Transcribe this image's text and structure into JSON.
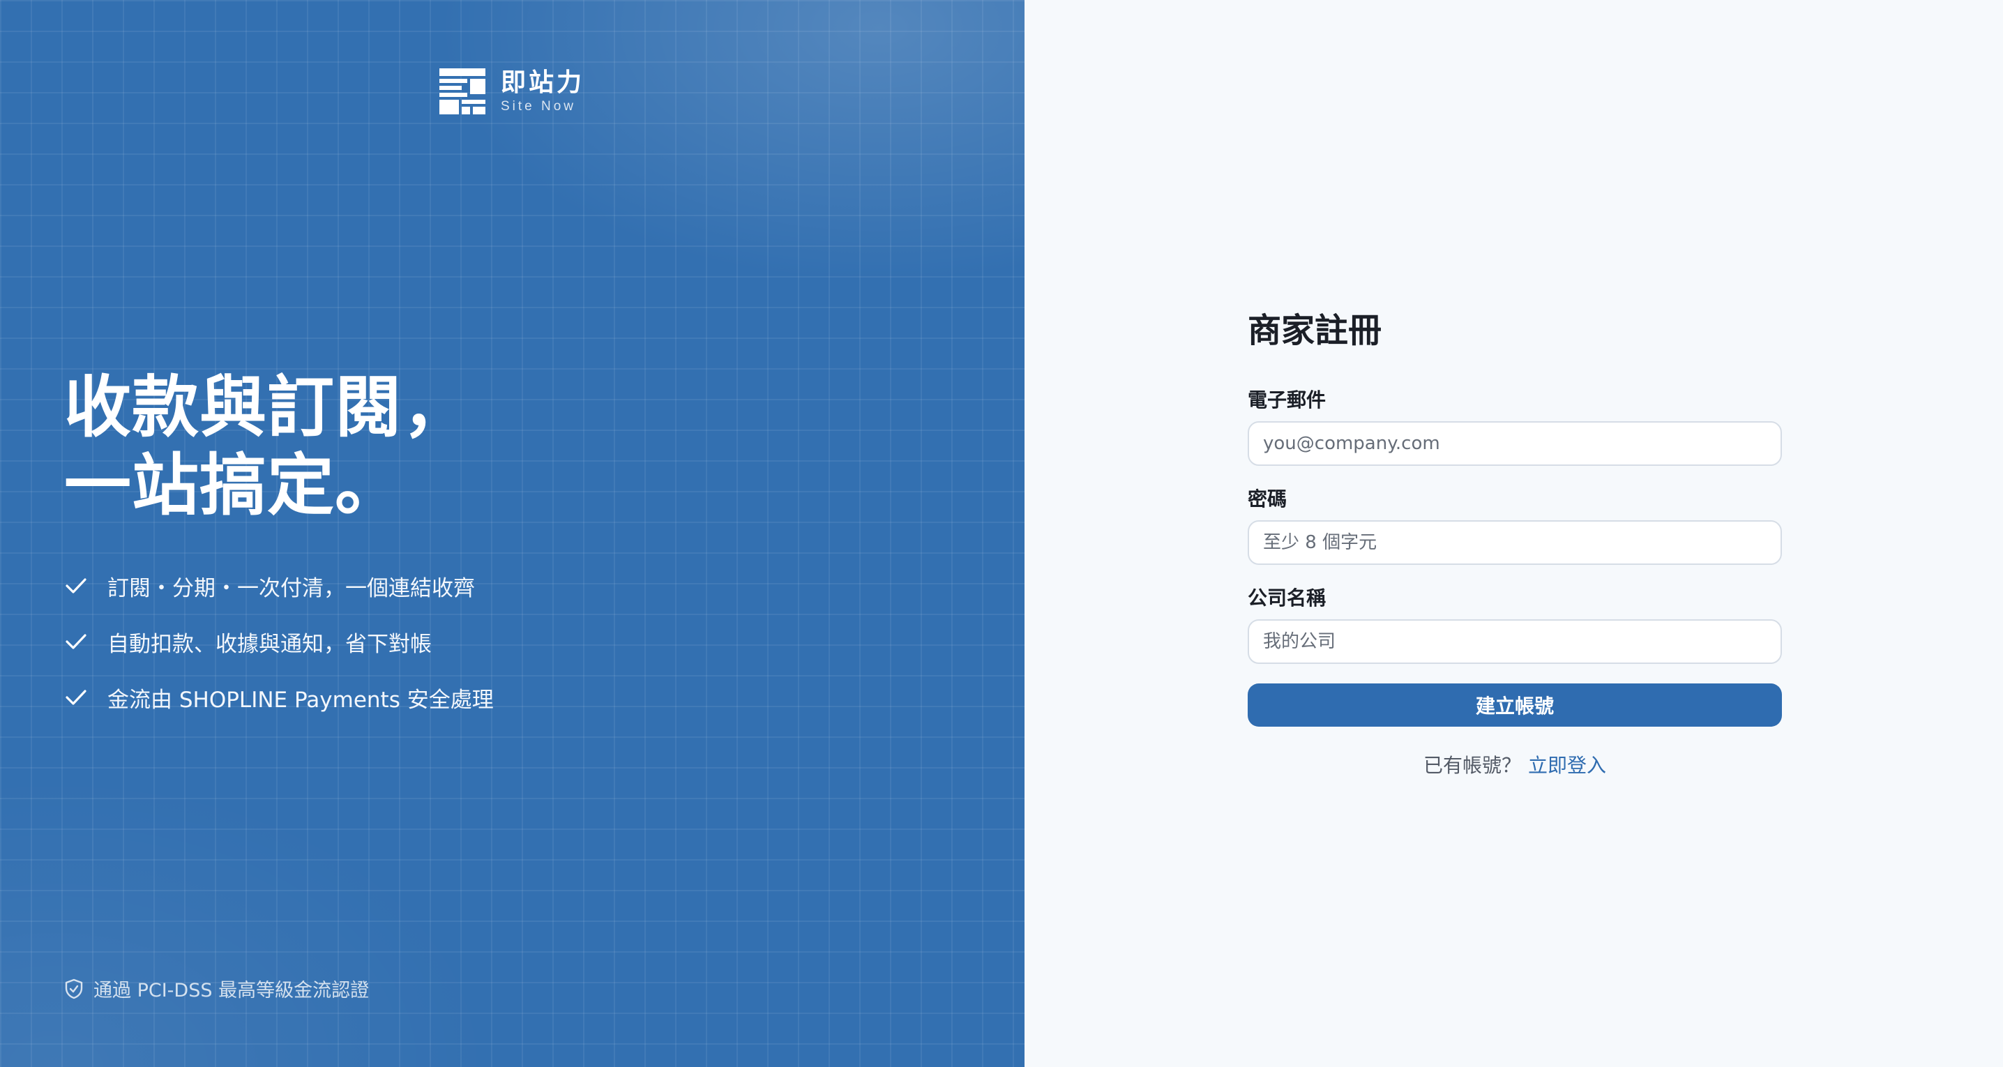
{
  "brand": {
    "name": "即站力",
    "tagline": "Site Now"
  },
  "hero": {
    "headline_line1": "收款與訂閱，",
    "headline_line2": "一站搞定。",
    "features": [
      {
        "icon": "check-icon",
        "text": "訂閱・分期・一次付清，一個連結收齊"
      },
      {
        "icon": "check-icon",
        "text": "自動扣款、收據與通知，省下對帳"
      },
      {
        "icon": "check-icon",
        "text": "金流由 SHOPLINE Payments 安全處理"
      }
    ],
    "footer_note": "通過 PCI-DSS 最高等級金流認證",
    "footer_icon": "shield-check-icon"
  },
  "form": {
    "title": "商家註冊",
    "email": {
      "label": "電子郵件",
      "placeholder": "you@company.com",
      "value": ""
    },
    "password": {
      "label": "密碼",
      "placeholder": "至少 8 個字元",
      "value": ""
    },
    "company": {
      "label": "公司名稱",
      "placeholder": "我的公司",
      "value": ""
    },
    "submit_label": "建立帳號",
    "signin_prompt": "已有帳號？",
    "signin_link": "立即登入"
  },
  "colors": {
    "panel_blue": "#3370b1",
    "button_blue": "#2f6cb0",
    "page_bg": "#f6f9fc",
    "text_dark": "#1b1f27"
  }
}
